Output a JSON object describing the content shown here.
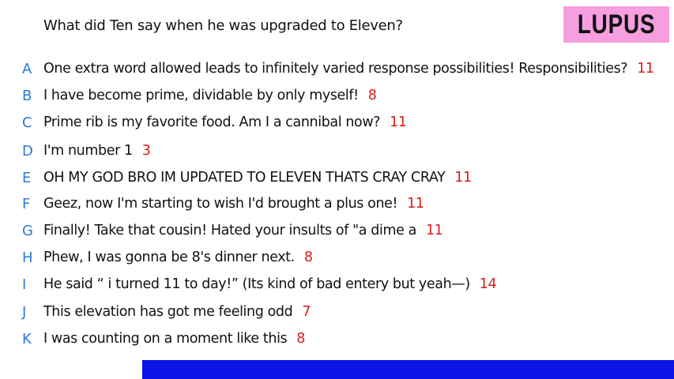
{
  "question": "What did Ten say when he was upgraded to Eleven?",
  "badge": "LUPUS",
  "colors": {
    "badge_bg": "#f59ee0",
    "letter": "#2a7ad6",
    "count": "#d81b1b",
    "bar": "#0a14e6"
  },
  "answers": [
    {
      "letter": "A",
      "text": "One extra word allowed leads to infinitely varied response possibilities! Responsibilities?",
      "count": "11"
    },
    {
      "letter": "B",
      "text": "I have become prime, dividable by only myself!",
      "count": "8"
    },
    {
      "letter": "C",
      "text": "Prime rib is my favorite food. Am I a cannibal now?",
      "count": "11"
    },
    {
      "letter": "D",
      "text": "I'm number 1",
      "count": "3"
    },
    {
      "letter": "E",
      "text": "OH MY GOD BRO IM UPDATED TO ELEVEN THATS CRAY CRAY",
      "count": "11"
    },
    {
      "letter": "F",
      "text": "Geez, now I'm starting to wish I'd brought a plus one!",
      "count": "11"
    },
    {
      "letter": "G",
      "text": "Finally! Take that cousin! Hated your insults of \"a dime a",
      "count": "11"
    },
    {
      "letter": "H",
      "text": "Phew, I was gonna be 8's dinner next.",
      "count": "8"
    },
    {
      "letter": "I",
      "text": "He said “ i turned 11 to day!” (Its kind of bad entery but yeah—)",
      "count": "14"
    },
    {
      "letter": "J",
      "text": "This elevation has got me feeling odd",
      "count": "7"
    },
    {
      "letter": "K",
      "text": "I was counting on a moment like this",
      "count": "8"
    }
  ]
}
